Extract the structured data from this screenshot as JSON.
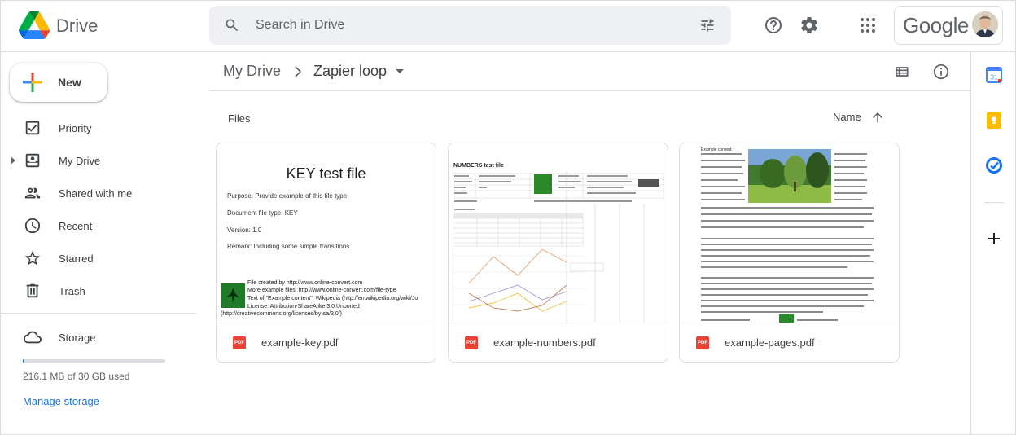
{
  "header": {
    "brand": "Drive",
    "search_placeholder": "Search in Drive",
    "account_wordmark": "Google"
  },
  "sidebar": {
    "new_label": "New",
    "items": [
      {
        "label": "Priority",
        "icon": "priority-icon"
      },
      {
        "label": "My Drive",
        "icon": "my-drive-icon"
      },
      {
        "label": "Shared with me",
        "icon": "shared-icon"
      },
      {
        "label": "Recent",
        "icon": "clock-icon"
      },
      {
        "label": "Starred",
        "icon": "star-icon"
      },
      {
        "label": "Trash",
        "icon": "trash-icon"
      }
    ],
    "storage_label": "Storage",
    "storage_used": "216.1 MB of 30 GB used",
    "storage_fraction": 0.007,
    "manage_storage": "Manage storage"
  },
  "breadcrumb": {
    "root": "My Drive",
    "current": "Zapier loop"
  },
  "files": {
    "section_label": "Files",
    "sort_label": "Name",
    "items": [
      {
        "name": "example-key.pdf",
        "preview": {
          "title": "KEY test file",
          "lines": [
            "Purpose: Provide example of this file type",
            "Document file type: KEY",
            "Version: 1.0",
            "Remark: Including some simple transitions"
          ],
          "credits": [
            "File created by http://www.online-convert.com",
            "More example files: http://www.online-convert.com/file-type",
            "Text of \"Example content\": Wikipedia (http://en.wikipedia.org/wiki/Jo",
            "License: Attribution-ShareAlike 3.0 Unported",
            "(http://creativecommons.org/licenses/by-sa/3.0/)"
          ]
        }
      },
      {
        "name": "example-numbers.pdf",
        "preview": {
          "title": "NUMBERS test file"
        }
      },
      {
        "name": "example-pages.pdf",
        "preview": {
          "heading": "Example content:"
        }
      }
    ]
  },
  "colors": {
    "accent": "#1a73e8",
    "pdf_red": "#ea4335",
    "search_bg": "#eef0f4"
  }
}
